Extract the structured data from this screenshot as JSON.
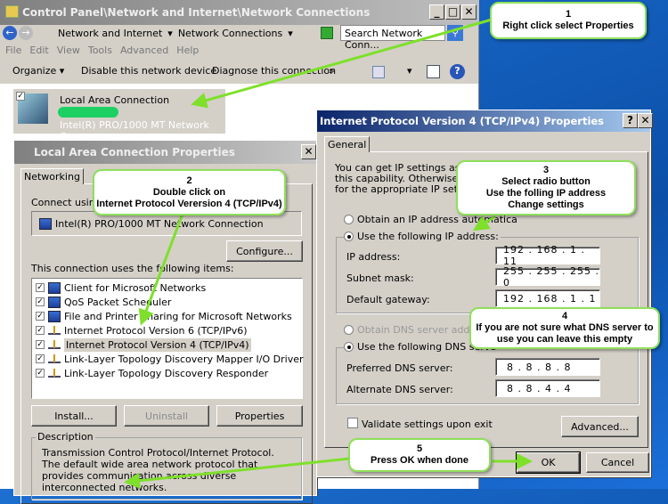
{
  "explorer": {
    "title": "Control Panel\\Network and Internet\\Network Connections",
    "breadcrumb": [
      "Network and Internet",
      "Network Connections"
    ],
    "search_placeholder": "Search Network Conn...",
    "menu": [
      "File",
      "Edit",
      "View",
      "Tools",
      "Advanced",
      "Help"
    ],
    "toolbar": {
      "organize": "Organize",
      "disable": "Disable this network device",
      "diagnose": "Diagnose this connection",
      "more": "»"
    },
    "connection": {
      "name": "Local Area Connection",
      "adapter": "Intel(R) PRO/1000 MT Network Con..."
    }
  },
  "lac_dialog": {
    "title": "Local Area Connection Properties",
    "tab": "Networking",
    "connect_using_label": "Connect using:",
    "adapter": "Intel(R) PRO/1000 MT Network Connection",
    "configure": "Configure...",
    "items_label": "This connection uses the following items:",
    "items": [
      {
        "label": "Client for Microsoft Networks",
        "checked": true,
        "icon": "client"
      },
      {
        "label": "QoS Packet Scheduler",
        "checked": true,
        "icon": "service"
      },
      {
        "label": "File and Printer Sharing for Microsoft Networks",
        "checked": true,
        "icon": "service"
      },
      {
        "label": "Internet Protocol Version 6 (TCP/IPv6)",
        "checked": true,
        "icon": "protocol"
      },
      {
        "label": "Internet Protocol Version 4 (TCP/IPv4)",
        "checked": true,
        "icon": "protocol",
        "selected": true
      },
      {
        "label": "Link-Layer Topology Discovery Mapper I/O Driver",
        "checked": true,
        "icon": "protocol"
      },
      {
        "label": "Link-Layer Topology Discovery Responder",
        "checked": true,
        "icon": "protocol"
      }
    ],
    "install": "Install...",
    "uninstall": "Uninstall",
    "properties": "Properties",
    "description_label": "Description",
    "description": "Transmission Control Protocol/Internet Protocol. The default wide area network protocol that provides communication across diverse interconnected networks."
  },
  "ipv4_dialog": {
    "title": "Internet Protocol Version 4 (TCP/IPv4) Properties",
    "tab": "General",
    "intro": [
      "You can get IP settings assigne",
      "this capability. Otherwise, you",
      "for the appropriate IP settings"
    ],
    "auto_ip": "Obtain an IP address automatica",
    "use_ip": "Use the following IP address:",
    "ip_label": "IP address:",
    "ip": "192 . 168 .  1  . 11",
    "mask_label": "Subnet mask:",
    "mask": "255 . 255 . 255 .  0",
    "gateway_label": "Default gateway:",
    "gateway": "192 . 168 .  1  .  1",
    "auto_dns": "Obtain DNS server address a",
    "use_dns": "Use the following DNS serve",
    "pref_label": "Preferred DNS server:",
    "pref": "8  .  8  .  8  .  8",
    "alt_label": "Alternate DNS server:",
    "alt": "8  .  8  .  4  .  4",
    "validate": "Validate settings upon exit",
    "advanced": "Advanced...",
    "ok": "OK",
    "cancel": "Cancel",
    "help_btn": "?",
    "close_btn": "✕"
  },
  "callouts": [
    {
      "num": "1",
      "lines": [
        "Right click select Properties"
      ]
    },
    {
      "num": "2",
      "lines": [
        "Double click on",
        "Internet Protocol Verersion 4 (TCP/IPv4)"
      ]
    },
    {
      "num": "3",
      "lines": [
        "Select radio button",
        "Use the folling IP address",
        "Change settings"
      ]
    },
    {
      "num": "4",
      "lines": [
        "If you are not sure what DNS server to",
        "use you can leave this empty"
      ]
    },
    {
      "num": "5",
      "lines": [
        "Press OK when done"
      ]
    }
  ],
  "colors": {
    "arrow": "#7ee02a",
    "callout_border": "#8ee05a",
    "active_title": "#0a246a",
    "desktop": "#0b4fa8"
  }
}
